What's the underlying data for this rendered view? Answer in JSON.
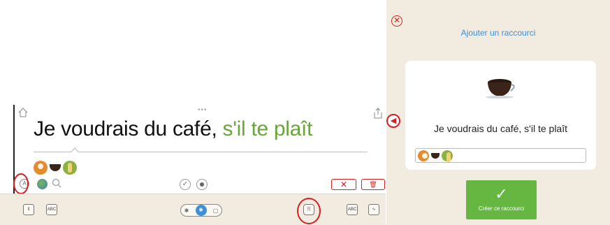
{
  "editor": {
    "sentence_main": "Je voudrais du café,",
    "sentence_green": "s'il te plaît",
    "more_dots": "•••",
    "pictograms": [
      "person-pictogram",
      "coffee-pictogram",
      "please-pictogram"
    ],
    "a_button_label": "A",
    "keyboard_label": "ABC",
    "delete_label": "✕",
    "trash_label": "🗑"
  },
  "bottom_bar": {
    "abc_play_label": "ABC",
    "segmented": [
      "✱",
      "◉",
      "▢"
    ]
  },
  "shortcut_panel": {
    "title": "Ajouter un raccourci",
    "close_label": "✕",
    "back_label": "◀",
    "card_sentence": "Je voudrais du café, s'il te plaît",
    "create_check": "✓",
    "create_label": "Créer ce raccourci"
  },
  "colors": {
    "accent_green": "#6aa53a",
    "button_green": "#65b742",
    "link_blue": "#3d8fd6",
    "alert_red": "#d42020",
    "panel_beige": "#f2ebe0"
  }
}
